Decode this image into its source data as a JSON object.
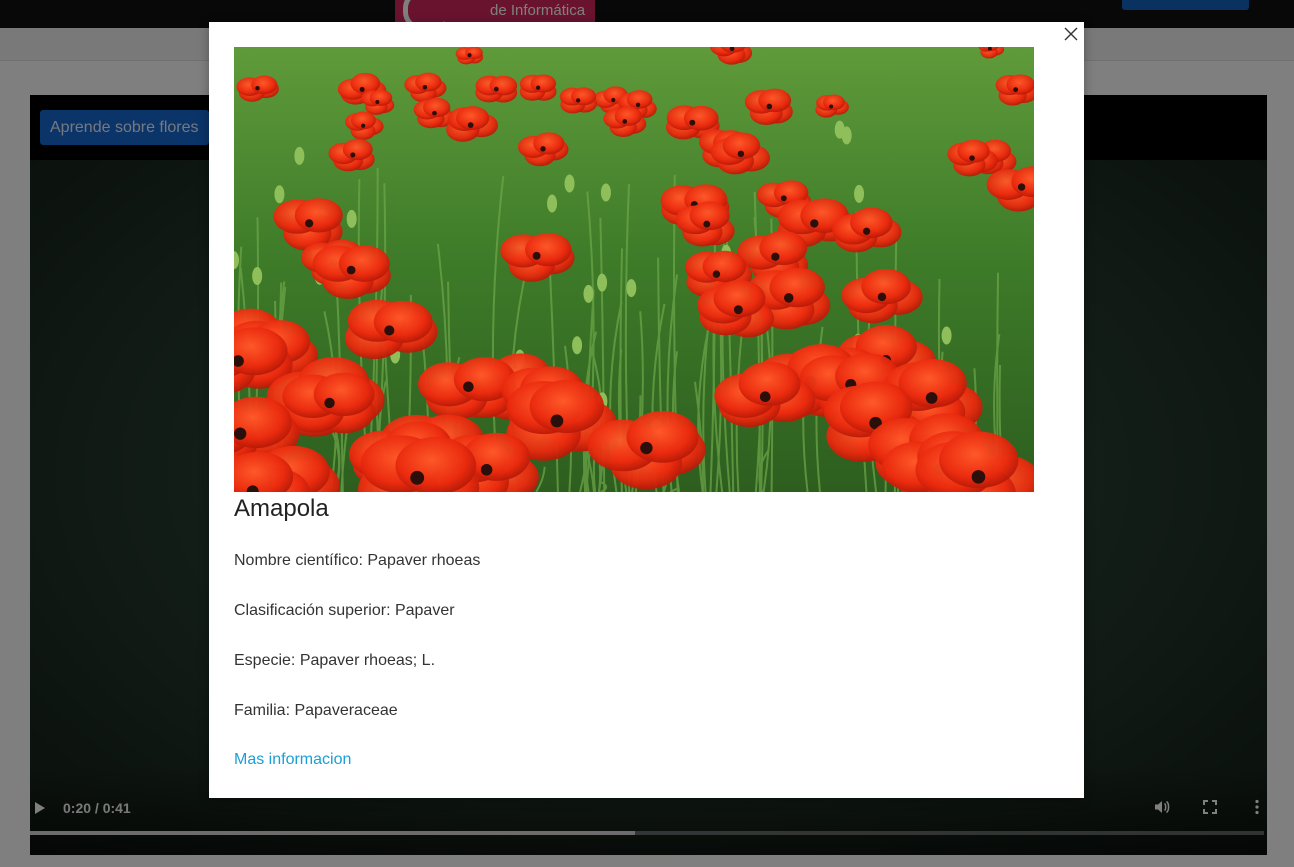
{
  "header": {
    "logo_text": "de Informática"
  },
  "video": {
    "learn_button_label": "Aprende sobre flores",
    "time_display": "0:20 / 0:41",
    "progress_fraction": 0.49,
    "icons": [
      "play-icon",
      "volume-icon",
      "fullscreen-icon",
      "more-options-icon"
    ]
  },
  "modal": {
    "image_subject": "field of red poppies",
    "title": "Amapola",
    "scientific_name": "Nombre científico: Papaver rhoeas",
    "higher_classification": "Clasificación superior: Papaver",
    "species": "Especie: Papaver rhoeas; L.",
    "family": "Familia: Papaveraceae",
    "more_link": "Mas informacion",
    "colors": {
      "link": "#1a9fd6",
      "accent_button": "#1769d1"
    }
  }
}
